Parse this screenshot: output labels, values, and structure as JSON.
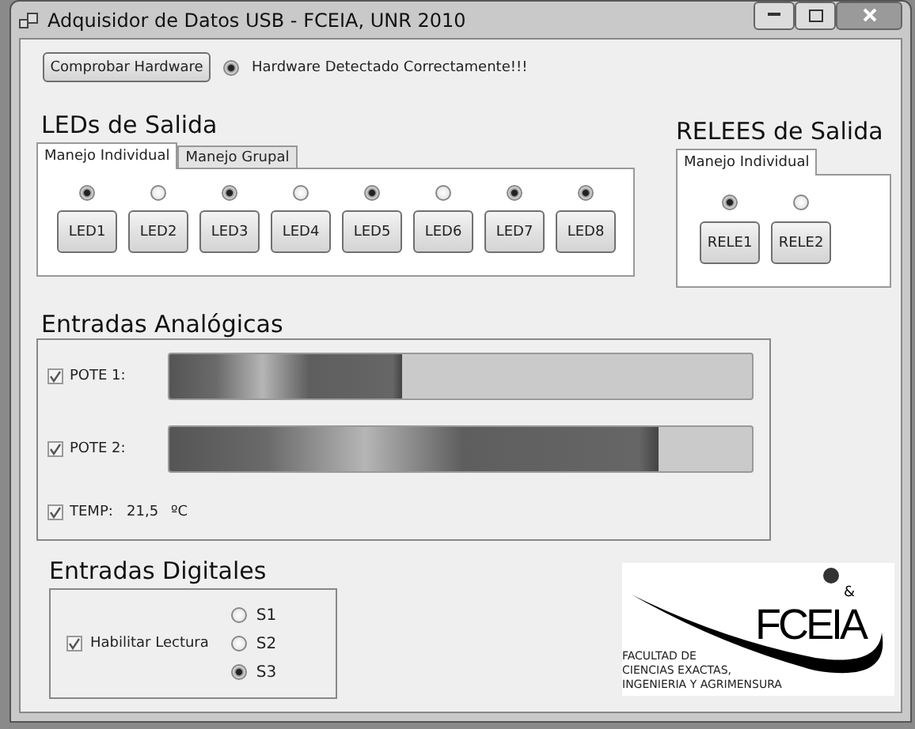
{
  "window": {
    "title": "Adquisidor de Datos USB - FCEIA, UNR 2010"
  },
  "hardware": {
    "button": "Comprobar Hardware",
    "status": "Hardware Detectado Correctamente!!!",
    "detected": true
  },
  "leds": {
    "heading": "LEDs de Salida",
    "tabs": [
      {
        "label": "Manejo Individual",
        "selected": true
      },
      {
        "label": "Manejo Grupal",
        "selected": false
      }
    ],
    "items": [
      {
        "label": "LED1",
        "on": true
      },
      {
        "label": "LED2",
        "on": false
      },
      {
        "label": "LED3",
        "on": true
      },
      {
        "label": "LED4",
        "on": false
      },
      {
        "label": "LED5",
        "on": true
      },
      {
        "label": "LED6",
        "on": false
      },
      {
        "label": "LED7",
        "on": true
      },
      {
        "label": "LED8",
        "on": true
      }
    ]
  },
  "relays": {
    "heading": "RELEES de Salida",
    "tabs": [
      {
        "label": "Manejo Individual",
        "selected": true
      }
    ],
    "items": [
      {
        "label": "RELE1",
        "on": true
      },
      {
        "label": "RELE2",
        "on": false
      }
    ]
  },
  "analog": {
    "heading": "Entradas Analógicas",
    "rows": [
      {
        "kind": "bar",
        "label": "POTE 1:",
        "checked": true,
        "level": 0.4
      },
      {
        "kind": "bar",
        "label": "POTE 2:",
        "checked": true,
        "level": 0.84
      },
      {
        "kind": "reading",
        "label": "TEMP:",
        "checked": true,
        "value": "21,5",
        "unit": "ºC"
      }
    ]
  },
  "digital": {
    "heading": "Entradas Digitales",
    "enable": {
      "label": "Habilitar Lectura",
      "checked": true
    },
    "inputs": [
      {
        "label": "S1",
        "selected": false
      },
      {
        "label": "S2",
        "selected": false
      },
      {
        "label": "S3",
        "selected": true
      }
    ]
  },
  "logo": {
    "name": "FCEIA",
    "ampersand": "&",
    "lines": [
      "FACULTAD DE",
      "CIENCIAS EXACTAS,",
      "INGENIERIA Y AGRIMENSURA"
    ]
  }
}
